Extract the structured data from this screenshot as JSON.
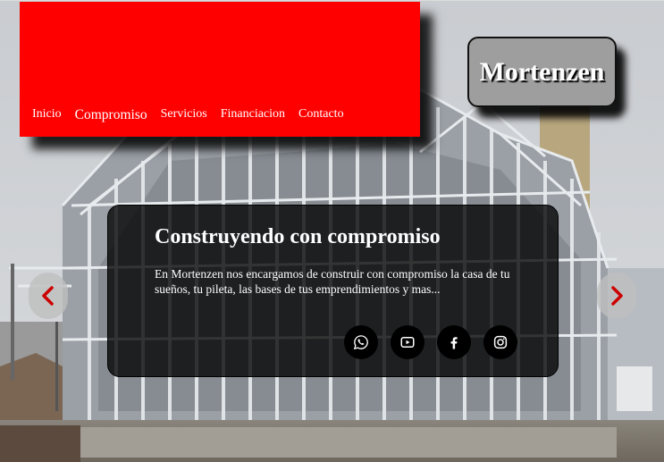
{
  "nav": {
    "links": [
      "Inicio",
      "Compromiso",
      "Servicios",
      "Financiacion",
      "Contacto"
    ],
    "active_index": 1,
    "background_color": "#ff0000"
  },
  "brand": {
    "name": "Mortenzen"
  },
  "hero": {
    "title": "Construyendo con compromiso",
    "description": "En Mortenzen nos encargamos de construir con compromiso la casa de tu sueños, tu pileta, las bases de tus emprendimientos y mas...",
    "arrow_color": "#cc0000"
  },
  "socials": [
    {
      "name": "whatsapp-icon"
    },
    {
      "name": "youtube-icon"
    },
    {
      "name": "facebook-icon"
    },
    {
      "name": "instagram-icon"
    }
  ],
  "carousel": {
    "prev_icon": "chevron-left-icon",
    "next_icon": "chevron-right-icon"
  }
}
